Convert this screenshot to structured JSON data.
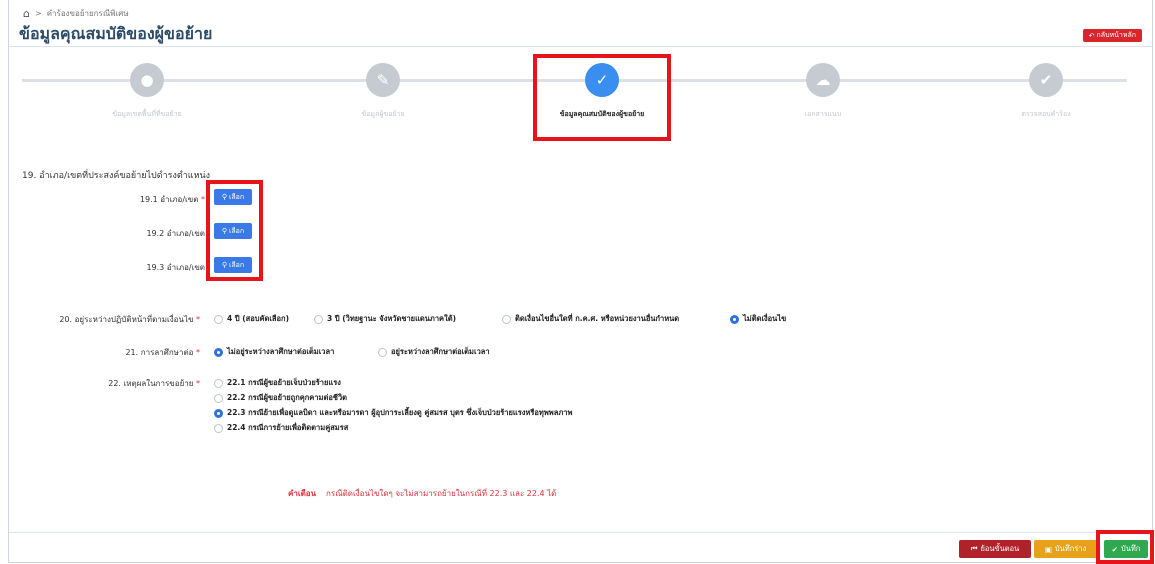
{
  "breadcrumb": {
    "home_icon": "home-icon",
    "sep": ">",
    "current": "คำร้องขอย้ายกรณีพิเศษ"
  },
  "title": "ข้อมูลคุณสมบัติของผู้ขอย้าย",
  "back_button": "กลับหน้าหลัก",
  "steps": [
    {
      "label": "ข้อมูลเขตพื้นที่ที่ขอย้าย",
      "icon": "map-pin-icon",
      "active": false
    },
    {
      "label": "ข้อมูลผู้ขอย้าย",
      "icon": "user-edit-icon",
      "active": false
    },
    {
      "label": "ข้อมูลคุณสมบัติของผู้ขอย้าย",
      "icon": "user-check-icon",
      "active": true
    },
    {
      "label": "เอกสารแนบ",
      "icon": "cloud-upload-icon",
      "active": false
    },
    {
      "label": "ตรวจสอบคำร้อง",
      "icon": "check-icon",
      "active": false
    }
  ],
  "q19": {
    "title": "19. อำเภอ/เขตที่ประสงค์ขอย้ายไปดำรงตำแหน่ง",
    "rows": [
      {
        "label": "19.1 อำเภอ/เขต",
        "required": true,
        "button": "เลือก"
      },
      {
        "label": "19.2 อำเภอ/เขต",
        "required": false,
        "button": "เลือก"
      },
      {
        "label": "19.3 อำเภอ/เขต",
        "required": false,
        "button": "เลือก"
      }
    ]
  },
  "q20": {
    "label": "20. อยู่ระหว่างปฏิบัติหน้าที่ตามเงื่อนไข",
    "options": [
      "4 ปี (สอบคัดเลือก)",
      "3 ปี (วิทยฐานะ จังหวัดชายแดนภาคใต้)",
      "ติดเงื่อนไขอื่นใดที่ ก.ค.ศ. หรือหน่วยงานอื่นกำหนด",
      "ไม่ติดเงื่อนไข"
    ],
    "selected": 3
  },
  "q21": {
    "label": "21. การลาศึกษาต่อ",
    "options": [
      "ไม่อยู่ระหว่างลาศึกษาต่อเต็มเวลา",
      "อยู่ระหว่างลาศึกษาต่อเต็มเวลา"
    ],
    "selected": 0
  },
  "q22": {
    "label": "22. เหตุผลในการขอย้าย",
    "options": [
      "22.1 กรณีผู้ขอย้ายเจ็บป่วยร้ายแรง",
      "22.2 กรณีผู้ขอย้ายถูกคุกคามต่อชีวิต",
      "22.3 กรณีย้ายเพื่อดูแลบิดา และหรือมารดา ผู้อุปการะเลี้ยงดู คู่สมรส บุตร ซึ่งเจ็บป่วยร้ายแรงหรือทุพพลภาพ",
      "22.4 กรณีการย้ายเพื่อติดตามคู่สมรส"
    ],
    "selected": 2
  },
  "warning": {
    "label": "คำเตือน",
    "text": "กรณีติดเงื่อนไขใดๆ จะไม่สามารถย้ายในกรณีที่ 22.3 และ 22.4 ได้"
  },
  "footer": {
    "prev": "ย้อนขั้นตอน",
    "draft": "บันทึกร่าง",
    "save": "บันทึก"
  },
  "colors": {
    "accent": "#3a8ef0",
    "danger": "#d9262d",
    "draft": "#e8a21a",
    "save": "#2fa84f",
    "highlight": "#e8141c"
  }
}
